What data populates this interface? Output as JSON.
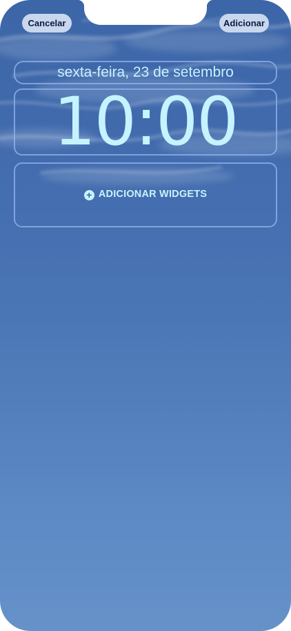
{
  "header": {
    "cancel_label": "Cancelar",
    "add_label": "Adicionar"
  },
  "lock_screen": {
    "date": "sexta-feira, 23 de setembro",
    "time": "10:00",
    "widgets_label": "ADICIONAR WIDGETS",
    "widgets_icon": "plus-circle-icon"
  },
  "colors": {
    "wallpaper_top": "#3c66a8",
    "wallpaper_bottom": "#6691c9",
    "clock_text": "#c6f3ff",
    "frame_border": "#96b4f0",
    "button_bg": "#c8d7ee",
    "button_text": "#0e1a3a"
  }
}
